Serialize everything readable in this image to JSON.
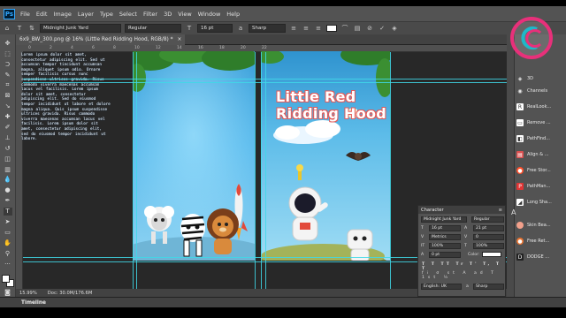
{
  "app": {
    "logo": "Ps",
    "menu": [
      "File",
      "Edit",
      "Image",
      "Layer",
      "Type",
      "Select",
      "Filter",
      "3D",
      "View",
      "Window",
      "Help"
    ]
  },
  "options_bar": {
    "font_family": "Midnight Junk Yard",
    "font_style": "Regular",
    "font_size": "16 pt",
    "antialias": "Sharp",
    "text_color": "#ffffff"
  },
  "document": {
    "tab_title": "6x9_BW_300.png @ 16% (Little Red Ridding Hood, RGB/8) *",
    "ruler_marks": [
      "0",
      "2",
      "4",
      "6",
      "8",
      "10",
      "12",
      "14",
      "16",
      "18",
      "20",
      "22"
    ]
  },
  "book": {
    "title_line1": "Little Red",
    "title_line2": "Ridding Hood",
    "body_text": "Lorem ipsum dolor sit amet, consectetur adipiscing elit. Sed ut accumsan tempor tincidunt accumsan magna, aliquet ipsum odio. Ornare semper facilisis cursus nunc suspendisse ultrices gravida. Risus commodo viverra maecenas accumsan lacus vel facilisis. Lorem ipsum dolor sit amet, consectetur adipiscing elit. Sed do eiusmod tempor incididunt ut labore et dolore magna aliqua. Quis ipsum suspendisse ultrices gravida. Risus commodo viverra maecenas accumsan lacus vel facilisis. Lorem ipsum dolor sit amet, consectetur adipiscing elit, sed do eiusmod tempor incididunt ut labore."
  },
  "status": {
    "zoom": "15.99%",
    "doc": "Doc: 30.0M/176.6M"
  },
  "timeline_label": "Timeline",
  "right_panels": [
    {
      "label": "3D",
      "icon": "cube-icon",
      "color": "#d0d0d0"
    },
    {
      "label": "Channels",
      "icon": "channels-icon",
      "color": "#d0d0d0"
    },
    {
      "label": "RealLook...",
      "icon": "plugin-icon",
      "color": "#ffffff"
    },
    {
      "label": "Remove ...",
      "icon": "plugin-icon",
      "color": "#ffffff"
    },
    {
      "label": "PathFind...",
      "icon": "plugin-icon",
      "color": "#ffffff"
    },
    {
      "label": "Align & ...",
      "icon": "plugin-icon",
      "color": "#d94f4f"
    },
    {
      "label": "Free Stor...",
      "icon": "plugin-icon",
      "color": "#ff4f2a"
    },
    {
      "label": "PathMan...",
      "icon": "plugin-icon",
      "color": "#e03535"
    },
    {
      "label": "Long Sha...",
      "icon": "plugin-icon",
      "color": "#ffffff"
    },
    {
      "label": "Skin Bea...",
      "icon": "plugin-icon",
      "color": "#f2a08b"
    },
    {
      "label": "Free Ret...",
      "icon": "plugin-icon",
      "color": "#e9722e"
    },
    {
      "label": "DODGE ...",
      "icon": "plugin-icon",
      "color": "#222222"
    }
  ],
  "character_panel": {
    "title": "Character",
    "font_family": "Midnight Junk Yard",
    "font_style": "Regular",
    "size": "16 pt",
    "leading": "21 pt",
    "kerning": "Metrics",
    "tracking": "0",
    "vscale": "100%",
    "hscale": "100%",
    "baseline": "0 pt",
    "color_label": "Color:",
    "language": "English: UK",
    "aa": "Sharp"
  }
}
